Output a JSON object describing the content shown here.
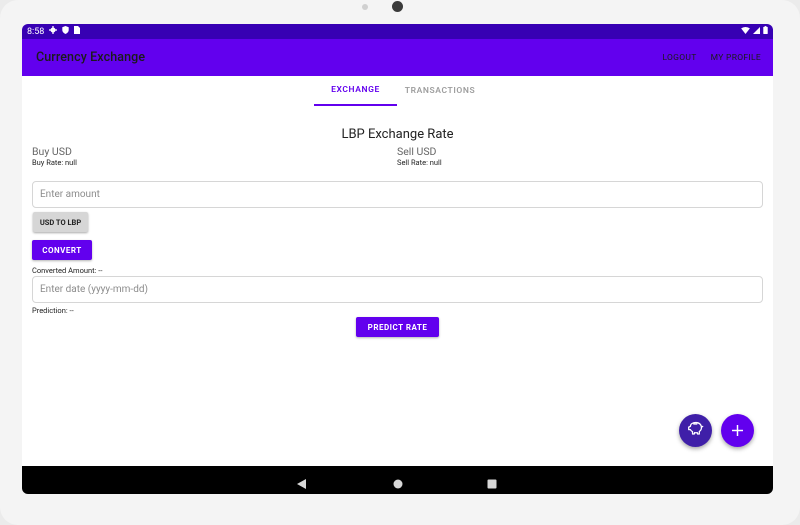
{
  "status_bar": {
    "time": "8:58"
  },
  "app_bar": {
    "title": "Currency Exchange",
    "actions": [
      "LOGOUT",
      "MY PROFILE"
    ]
  },
  "tabs": [
    {
      "label": "EXCHANGE",
      "selected": true
    },
    {
      "label": "TRANSACTIONS",
      "selected": false
    }
  ],
  "exchange": {
    "title": "LBP Exchange Rate",
    "buy_label": "Buy USD",
    "buy_rate": "Buy Rate: null",
    "sell_label": "Sell USD",
    "sell_rate": "Sell Rate: null",
    "amount_placeholder": "Enter amount",
    "amount_value": "",
    "direction_button": "USD TO LBP",
    "convert_button": "CONVERT",
    "converted_text": "Converted Amount: --",
    "date_placeholder": "Enter date (yyyy-mm-dd)",
    "date_value": "",
    "prediction_text": "Prediction: --",
    "predict_button": "PREDICT RATE"
  },
  "fabs": [
    {
      "icon": "piggy-bank-icon"
    },
    {
      "icon": "plus-icon"
    }
  ],
  "colors": {
    "primary": "#6200ee",
    "primary_dark": "#3700b3",
    "secondary_fab": "#3f1fa8"
  }
}
